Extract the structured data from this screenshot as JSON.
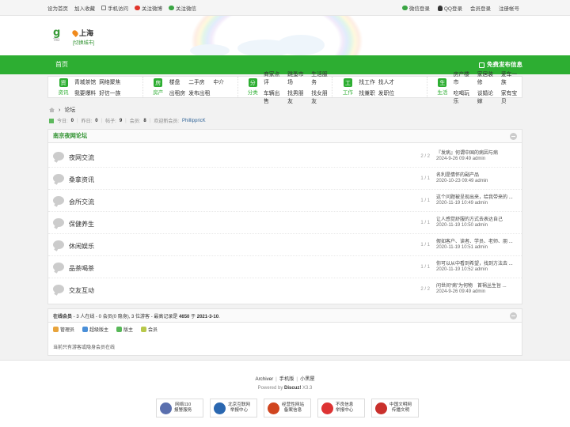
{
  "topbar": {
    "left": [
      "设为首页",
      "加入收藏",
      "手机访问",
      "关注微博",
      "关注微信"
    ],
    "right": [
      "微信登录",
      "QQ登录",
      "会员登录",
      "注册帐号"
    ]
  },
  "header": {
    "logo_text": "g",
    "logo_sub": "TRD",
    "city": "上海",
    "switch_city": "[切换城市]"
  },
  "nav": {
    "home": "首页",
    "post": "免费发布信息"
  },
  "categories": [
    {
      "label": "资讯",
      "icon": "资",
      "links": [
        "青城茶馆",
        "网络聚焦",
        "",
        "我要爆料",
        "好信一族",
        ""
      ]
    },
    {
      "label": "房产",
      "icon": "房",
      "links": [
        "楼盘",
        "二手房",
        "中介",
        "出租房",
        "发布出租",
        ""
      ]
    },
    {
      "label": "分类",
      "icon": "分",
      "links": [
        "商家点评",
        "跳蚤市场",
        "生活服务",
        "车辆出售",
        "找男朋友",
        "找女朋友"
      ]
    },
    {
      "label": "工作",
      "icon": "工",
      "links": [
        "找工作",
        "找人才",
        "",
        "找兼职",
        "发职位",
        ""
      ]
    },
    {
      "label": "生活",
      "icon": "生",
      "links": [
        "房产楼市",
        "家居装修",
        "爱车一族",
        "吃喝玩乐",
        "谈婚论嫁",
        "家有宝贝"
      ]
    }
  ],
  "breadcrumb": {
    "current": "论坛"
  },
  "stats": {
    "today_label": "今日:",
    "today": "0",
    "yesterday_label": "昨日:",
    "yesterday": "0",
    "posts_label": "帖子:",
    "posts": "9",
    "members_label": "会员:",
    "members": "8",
    "welcome": "欢迎新会员:",
    "new_member": "PhillippricK"
  },
  "forum": {
    "title": "南京夜网论坛",
    "rows": [
      {
        "name": "夜网交流",
        "count": "2 / 2",
        "last_title": "『发病』何谓中国的病因与病",
        "last_meta": "2024-9-26 09:49 admin"
      },
      {
        "name": "桑拿资讯",
        "count": "1 / 1",
        "last_title": "名利是情怀的副产品",
        "last_meta": "2020-10-23 09:49 admin"
      },
      {
        "name": "会所交流",
        "count": "1 / 1",
        "last_title": "这个问题被呈现出来，给我带来的 ...",
        "last_meta": "2020-11-19 10:49 admin"
      },
      {
        "name": "保健养生",
        "count": "1 / 1",
        "last_title": "让人感觉舒服的方式去表达自己",
        "last_meta": "2020-11-19 10:50 admin"
      },
      {
        "name": "休闲娱乐",
        "count": "1 / 1",
        "last_title": "假如客户、读者、学员、老师、朋 ...",
        "last_meta": "2020-11-19 10:51 admin"
      },
      {
        "name": "品茶喝茶",
        "count": "1 / 1",
        "last_title": "你可以从中看到希望，找到方法去 ...",
        "last_meta": "2020-11-19 10:52 admin"
      },
      {
        "name": "交友互动",
        "count": "2 / 2",
        "last_title": "问世间“病”为何物　首祸丛生旨 ...",
        "last_meta": "2024-9-26 09:49 admin"
      }
    ]
  },
  "online": {
    "title": "在线会员",
    "summary": " - 3 人在线 - 0 会员(0 隐身), 3 位游客 - 最高记录是 ",
    "record": "4650",
    "record_date_prefix": " 于 ",
    "record_date": "2021-3-10",
    "legend": [
      {
        "label": "管理员",
        "color": "#e8a43c"
      },
      {
        "label": "超级版主",
        "color": "#4a8fd8"
      },
      {
        "label": "版主",
        "color": "#58b858"
      },
      {
        "label": "会员",
        "color": "#b8c84a"
      }
    ],
    "note": "当前只有游客或隐身会员在线"
  },
  "footer": {
    "links": [
      "Archiver",
      "手机版",
      "小黑屋"
    ],
    "powered_prefix": "Powered by ",
    "powered_name": "Discuz!",
    "powered_ver": " X3.3",
    "badges": [
      {
        "line1": "网络110",
        "line2": "报警服务",
        "color": "#5a6fae"
      },
      {
        "line1": "北京互联网",
        "line2": "举报中心",
        "color": "#2a67b0"
      },
      {
        "line1": "经营性网站",
        "line2": "备案信息",
        "color": "#d0451f"
      },
      {
        "line1": "不良信息",
        "line2": "举报中心",
        "color": "#d33"
      },
      {
        "line1": "中国文明网",
        "line2": "传播文明",
        "color": "#c9302c"
      }
    ]
  }
}
